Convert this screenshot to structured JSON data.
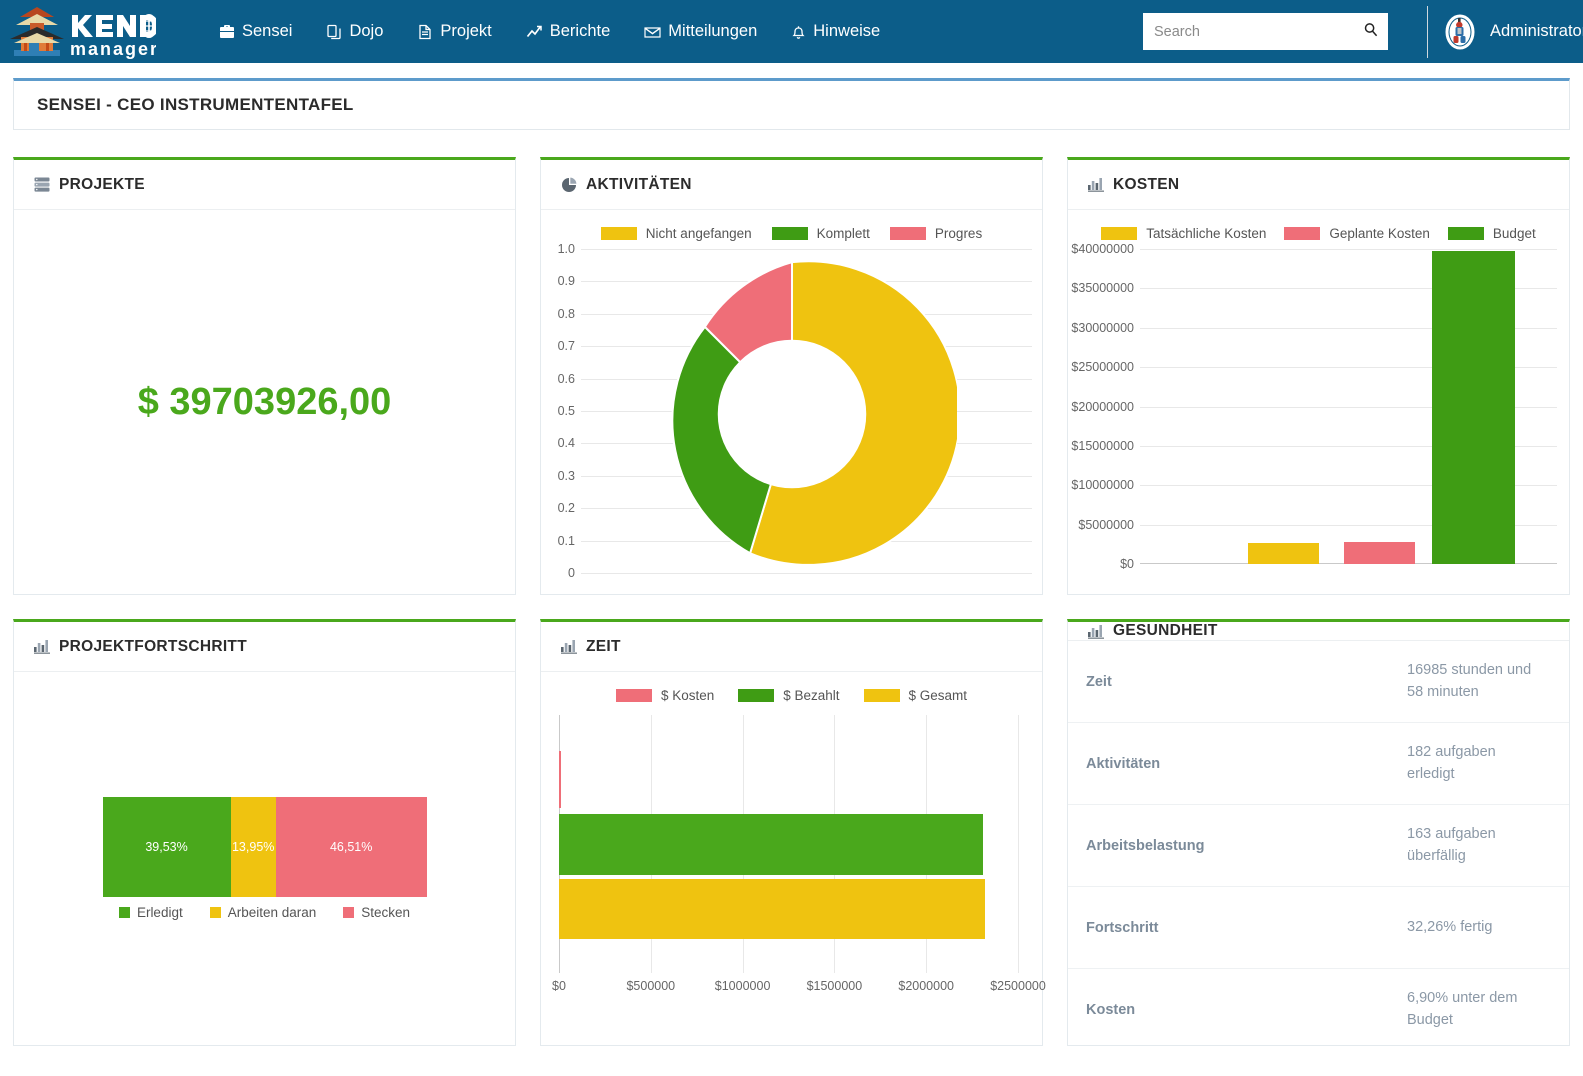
{
  "brand": {
    "name_top": "KENDO",
    "name_bottom": "manager"
  },
  "nav": {
    "items": [
      {
        "label": "Sensei",
        "icon": "briefcase-icon"
      },
      {
        "label": "Dojo",
        "icon": "copy-icon"
      },
      {
        "label": "Projekt",
        "icon": "file-icon"
      },
      {
        "label": "Berichte",
        "icon": "line-chart-icon"
      },
      {
        "label": "Mitteilungen",
        "icon": "envelope-icon"
      },
      {
        "label": "Hinweise",
        "icon": "bell-icon"
      }
    ]
  },
  "search": {
    "value": "",
    "placeholder": "Search",
    "icon": "search-icon"
  },
  "user": {
    "name": "Administrator",
    "avatar_icon": "avatar-icon"
  },
  "page": {
    "title": "SENSEI - CEO INSTRUMENTENTAFEL"
  },
  "cards": {
    "projekte": {
      "title": "PROJEKTE",
      "icon": "server-list-icon",
      "value": "$ 39703926,00"
    },
    "aktivitaeten": {
      "title": "AKTIVITÄTEN",
      "icon": "pie-chart-icon"
    },
    "kosten": {
      "title": "KOSTEN",
      "icon": "bar-chart-icon"
    },
    "projektfortschritt": {
      "title": "PROJEKTFORTSCHRITT",
      "icon": "bar-chart-icon"
    },
    "zeit": {
      "title": "ZEIT",
      "icon": "bar-chart-icon"
    },
    "gesundheit": {
      "title": "GESUNDHEIT",
      "icon": "bar-chart-icon"
    }
  },
  "colors": {
    "yellow": "#efc310",
    "green": "#4aa81c",
    "pink": "#ef6e78",
    "header_blue": "#0c5d89",
    "title_border": "#5d9bcb",
    "card_border_top": "#4aa81c",
    "money_green": "#4aa81c"
  },
  "health": {
    "rows": [
      {
        "key": "Zeit",
        "value": "16985 stunden und 58 minuten"
      },
      {
        "key": "Aktivitäten",
        "value": "182 aufgaben erledigt"
      },
      {
        "key": "Arbeitsbelastung",
        "value": "163 aufgaben überfällig"
      },
      {
        "key": "Fortschritt",
        "value": "32,26% fertig"
      },
      {
        "key": "Kosten",
        "value": "6,90% unter dem Budget"
      }
    ]
  },
  "chart_data": [
    {
      "id": "aktivitaeten",
      "type": "pie",
      "title": "AKTIVITÄTEN",
      "variant": "donut",
      "legend_position": "top",
      "labels": [
        "Nicht angefangen",
        "Komplett",
        "Progres"
      ],
      "values": [
        54.4,
        30.3,
        15.3
      ],
      "colors": [
        "#efc310",
        "#4aa81c",
        "#ef6e78"
      ],
      "yticks": [
        "1.0",
        "0.9",
        "0.8",
        "0.7",
        "0.6",
        "0.5",
        "0.4",
        "0.3",
        "0.2",
        "0.1",
        "0"
      ],
      "ylim": [
        0,
        1
      ],
      "grid": true
    },
    {
      "id": "kosten",
      "type": "bar",
      "title": "KOSTEN",
      "legend_position": "top",
      "categories": [
        "Tatsächliche Kosten",
        "Geplante Kosten",
        "Budget"
      ],
      "values": [
        2700000,
        2750000,
        39700000
      ],
      "colors": [
        "#efc310",
        "#ef6e78",
        "#4aa81c"
      ],
      "ylabel": "",
      "xlabel": "",
      "ylim": [
        0,
        40000000
      ],
      "yticks": [
        "$0",
        "$5000000",
        "$10000000",
        "$15000000",
        "$20000000",
        "$25000000",
        "$30000000",
        "$35000000",
        "$40000000"
      ],
      "grid": true
    },
    {
      "id": "projektfortschritt",
      "type": "bar",
      "variant": "stacked-100",
      "title": "PROJEKTFORTSCHRITT",
      "legend_position": "bottom",
      "categories": [
        "Erledigt",
        "Arbeiten daran",
        "Stecken"
      ],
      "values": [
        39.53,
        13.95,
        46.51
      ],
      "data_labels": [
        "39,53%",
        "13,95%",
        "46,51%"
      ],
      "colors": [
        "#4aa81c",
        "#efc310",
        "#ef6e78"
      ],
      "grid": false
    },
    {
      "id": "zeit",
      "type": "bar",
      "variant": "horizontal",
      "title": "ZEIT",
      "legend_position": "top",
      "categories": [
        "$ Kosten",
        "$ Bezahlt",
        "$ Gesamt"
      ],
      "values": [
        6000,
        2310000,
        2320000
      ],
      "colors": [
        "#ef6e78",
        "#4aa81c",
        "#efc310"
      ],
      "xlim": [
        0,
        2500000
      ],
      "xticks": [
        "$0",
        "$500000",
        "$1000000",
        "$1500000",
        "$2000000",
        "$2500000"
      ],
      "grid": true
    }
  ]
}
